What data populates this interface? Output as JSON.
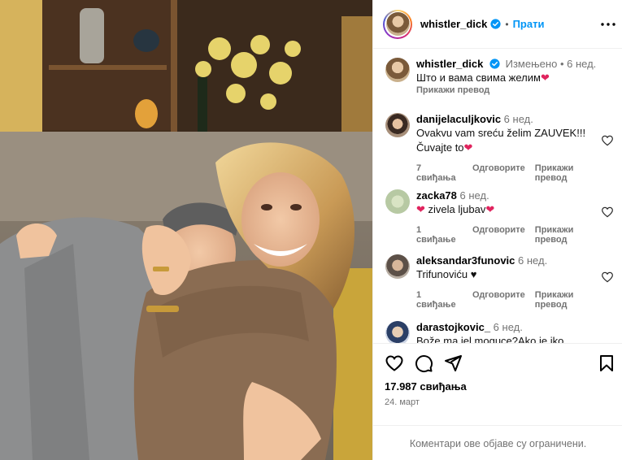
{
  "post": {
    "username": "whistler_dick",
    "follow_label": "Прати",
    "more_label": "•••",
    "image_alt": "photo"
  },
  "caption": {
    "username": "whistler_dick",
    "edited_label": "Измењено",
    "time": "6 нед.",
    "text": "Што и вама свима желим",
    "translate_label": "Прикажи превод"
  },
  "comments": [
    {
      "username": "danijelaculjkovic",
      "time": "6 нед.",
      "text_line1": "Ovakvu vam sreću želim ZAUVEK!!!",
      "text_line2": "Čuvajte to",
      "likes_label": "7 свиђања",
      "reply_label": "Одговорите",
      "translate_label": "Прикажи превод"
    },
    {
      "username": "zacka78",
      "time": "6 нед.",
      "text": "zivela ljubav",
      "likes_label": "1 свиђање",
      "reply_label": "Одговорите",
      "translate_label": "Прикажи превод"
    },
    {
      "username": "aleksandar3funovic",
      "time": "6 нед.",
      "text": "Trifunoviću",
      "likes_label": "1 свиђање",
      "reply_label": "Одговорите",
      "translate_label": "Прикажи превод"
    },
    {
      "username": "darastojkovic_",
      "time": "6 нед.",
      "text": "Bože ma jel moguce?Ako je iko"
    }
  ],
  "stats": {
    "likes": "17.987 свиђања",
    "date": "24. март"
  },
  "footer": {
    "restricted_text": "Коментари ове објаве су ограничени."
  },
  "colors": {
    "accent": "#0095f6",
    "heart": "#e0245e",
    "muted": "#737373"
  }
}
